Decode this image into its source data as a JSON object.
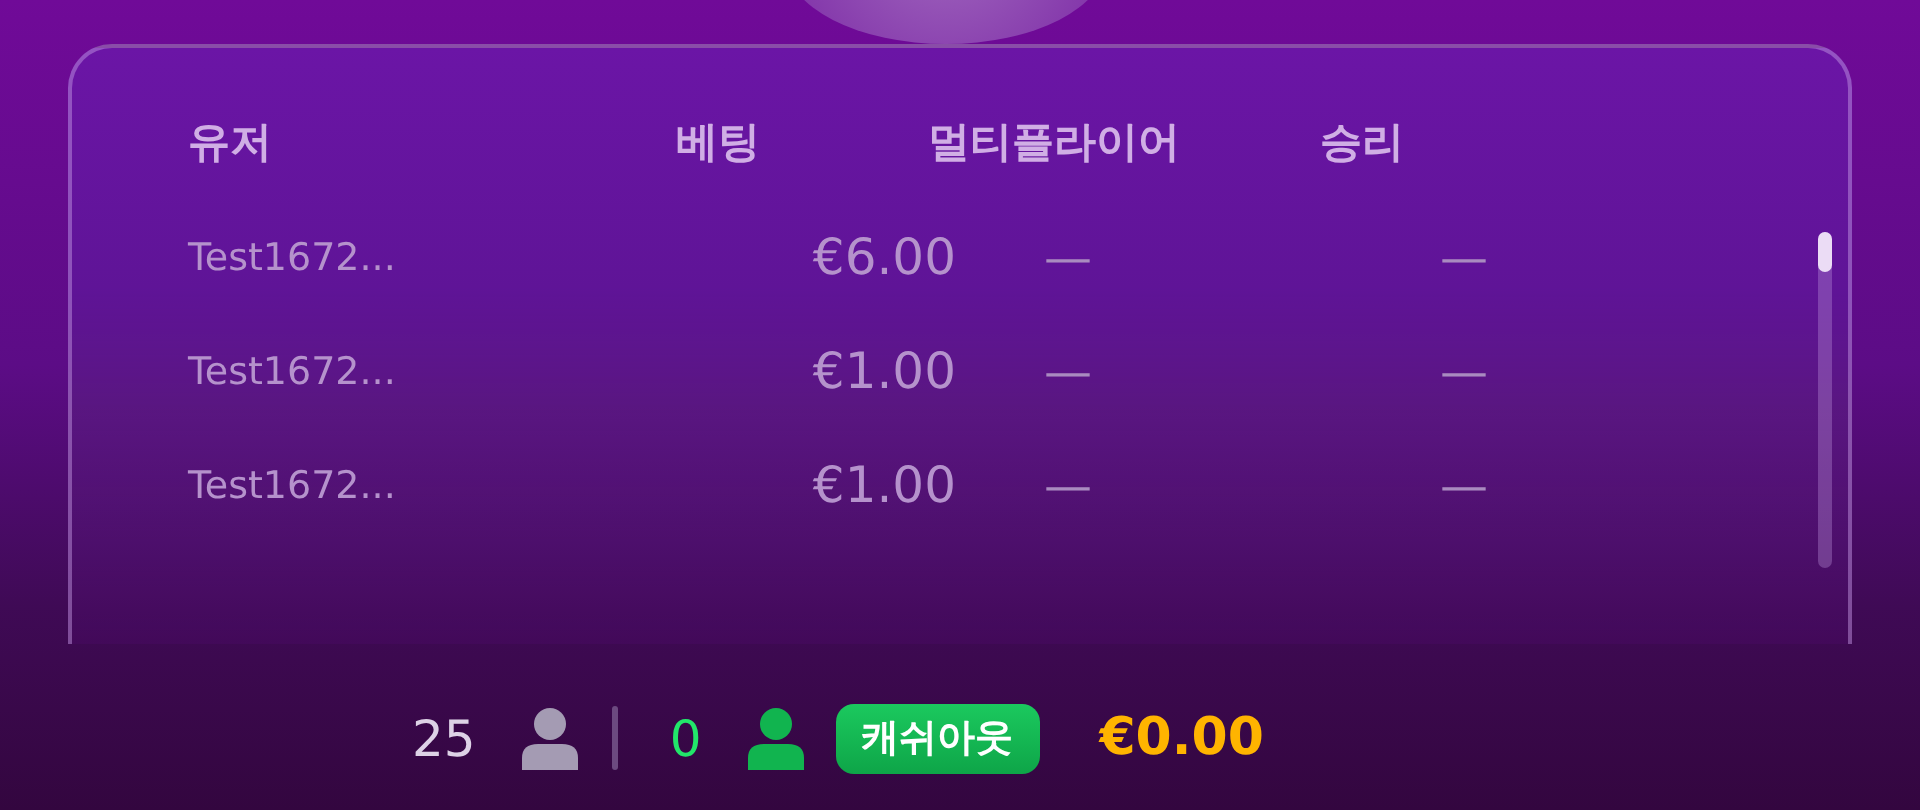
{
  "table": {
    "columns": [
      "유저",
      "베팅",
      "멀티플라이어",
      "승리"
    ],
    "rows": [
      {
        "user": "Test1672...",
        "bet": "€6.00",
        "multiplier": "—",
        "win": "—"
      },
      {
        "user": "Test1672...",
        "bet": "€1.00",
        "multiplier": "—",
        "win": "—"
      },
      {
        "user": "Test1672...",
        "bet": "€1.00",
        "multiplier": "—",
        "win": "—"
      }
    ]
  },
  "footer": {
    "players": "25",
    "cashed_out": "0",
    "cashout_label": "캐쉬아웃",
    "total": "€0.00"
  }
}
